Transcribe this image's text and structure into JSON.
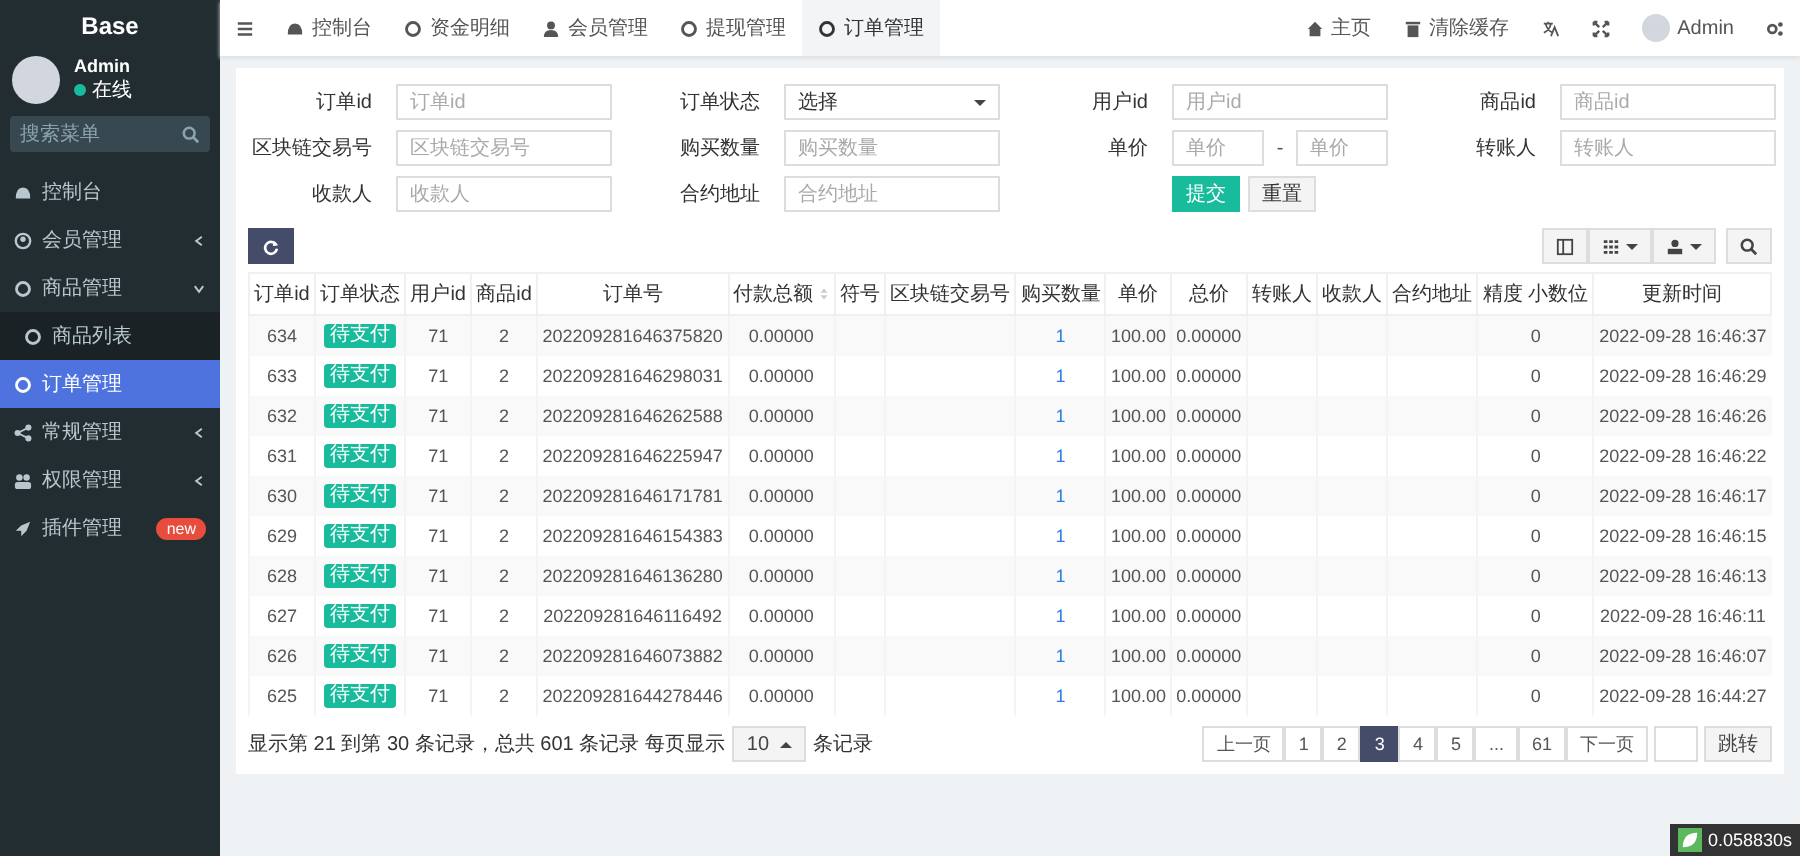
{
  "sidebar": {
    "logo": "Base",
    "user": {
      "name": "Admin",
      "status": "在线"
    },
    "search": {
      "placeholder": "搜索菜单"
    },
    "menu": [
      {
        "label": "控制台",
        "selected": false
      },
      {
        "label": "会员管理",
        "selected": false,
        "expanded": false
      },
      {
        "label": "商品管理",
        "selected": false,
        "expanded": true,
        "children": [
          {
            "label": "商品列表",
            "selected": false
          }
        ]
      },
      {
        "label": "订单管理",
        "selected": true
      },
      {
        "label": "常规管理",
        "selected": false,
        "expanded": false
      },
      {
        "label": "权限管理",
        "selected": false,
        "expanded": false
      },
      {
        "label": "插件管理",
        "selected": false,
        "badge": "new"
      }
    ]
  },
  "topbar": {
    "tabs": [
      {
        "label": "控制台",
        "selected": false
      },
      {
        "label": "资金明细",
        "selected": false
      },
      {
        "label": "会员管理",
        "selected": false
      },
      {
        "label": "提现管理",
        "selected": false
      },
      {
        "label": "订单管理",
        "selected": true
      }
    ],
    "links": [
      "主页",
      "清除缓存"
    ],
    "user": "Admin"
  },
  "filter": {
    "fields": [
      {
        "label": "订单id",
        "kind": "input",
        "placeholder": "订单id"
      },
      {
        "label": "订单状态",
        "kind": "select",
        "value": "选择"
      },
      {
        "label": "用户id",
        "kind": "input",
        "placeholder": "用户id"
      },
      {
        "label": "商品id",
        "kind": "input",
        "placeholder": "商品id"
      },
      {
        "label": "区块链交易号",
        "kind": "input",
        "placeholder": "区块链交易号"
      },
      {
        "label": "购买数量",
        "kind": "input",
        "placeholder": "购买数量"
      },
      {
        "label": "单价",
        "kind": "range",
        "placeholder": "单价",
        "placeholder_to": "单价",
        "separator": "-"
      },
      {
        "label": "转账人",
        "kind": "input",
        "placeholder": "转账人"
      },
      {
        "label": "收款人",
        "kind": "input",
        "placeholder": "收款人"
      },
      {
        "label": "合约地址",
        "kind": "input",
        "placeholder": "合约地址"
      },
      {
        "kind": "buttons",
        "submit": "提交",
        "reset": "重置"
      }
    ]
  },
  "table": {
    "columns": [
      {
        "label": "订单id",
        "kind": "text"
      },
      {
        "label": "订单状态",
        "kind": "badge"
      },
      {
        "label": "用户id",
        "kind": "text"
      },
      {
        "label": "商品id",
        "kind": "text"
      },
      {
        "label": "订单号",
        "kind": "text"
      },
      {
        "label": "付款总额",
        "kind": "text",
        "sortable": true
      },
      {
        "label": "符号"
      },
      {
        "label": "区块链交易号"
      },
      {
        "label": "购买数量",
        "kind": "link"
      },
      {
        "label": "单价",
        "kind": "text"
      },
      {
        "label": "总价",
        "kind": "text"
      },
      {
        "label": "转账人"
      },
      {
        "label": "收款人"
      },
      {
        "label": "合约地址"
      },
      {
        "label": "精度 小数位",
        "kind": "text"
      },
      {
        "label": "更新时间",
        "kind": "text"
      }
    ],
    "rows": [
      {
        "cells": [
          "634",
          "待支付",
          "71",
          "2",
          "202209281646375820",
          "0.00000",
          "",
          "",
          "1",
          "100.00",
          "0.00000",
          "",
          "",
          "",
          "0",
          "2022-09-28 16:46:37"
        ]
      },
      {
        "cells": [
          "633",
          "待支付",
          "71",
          "2",
          "202209281646298031",
          "0.00000",
          "",
          "",
          "1",
          "100.00",
          "0.00000",
          "",
          "",
          "",
          "0",
          "2022-09-28 16:46:29"
        ]
      },
      {
        "cells": [
          "632",
          "待支付",
          "71",
          "2",
          "202209281646262588",
          "0.00000",
          "",
          "",
          "1",
          "100.00",
          "0.00000",
          "",
          "",
          "",
          "0",
          "2022-09-28 16:46:26"
        ]
      },
      {
        "cells": [
          "631",
          "待支付",
          "71",
          "2",
          "202209281646225947",
          "0.00000",
          "",
          "",
          "1",
          "100.00",
          "0.00000",
          "",
          "",
          "",
          "0",
          "2022-09-28 16:46:22"
        ]
      },
      {
        "cells": [
          "630",
          "待支付",
          "71",
          "2",
          "202209281646171781",
          "0.00000",
          "",
          "",
          "1",
          "100.00",
          "0.00000",
          "",
          "",
          "",
          "0",
          "2022-09-28 16:46:17"
        ]
      },
      {
        "cells": [
          "629",
          "待支付",
          "71",
          "2",
          "202209281646154383",
          "0.00000",
          "",
          "",
          "1",
          "100.00",
          "0.00000",
          "",
          "",
          "",
          "0",
          "2022-09-28 16:46:15"
        ]
      },
      {
        "cells": [
          "628",
          "待支付",
          "71",
          "2",
          "202209281646136280",
          "0.00000",
          "",
          "",
          "1",
          "100.00",
          "0.00000",
          "",
          "",
          "",
          "0",
          "2022-09-28 16:46:13"
        ]
      },
      {
        "cells": [
          "627",
          "待支付",
          "71",
          "2",
          "202209281646116492",
          "0.00000",
          "",
          "",
          "1",
          "100.00",
          "0.00000",
          "",
          "",
          "",
          "0",
          "2022-09-28 16:46:11"
        ]
      },
      {
        "cells": [
          "626",
          "待支付",
          "71",
          "2",
          "202209281646073882",
          "0.00000",
          "",
          "",
          "1",
          "100.00",
          "0.00000",
          "",
          "",
          "",
          "0",
          "2022-09-28 16:46:07"
        ]
      },
      {
        "cells": [
          "625",
          "待支付",
          "71",
          "2",
          "202209281644278446",
          "0.00000",
          "",
          "",
          "1",
          "100.00",
          "0.00000",
          "",
          "",
          "",
          "0",
          "2022-09-28 16:44:27"
        ]
      }
    ]
  },
  "footer": {
    "summary": "显示第 21 到第 30 条记录，总共 601 条记录 每页显示",
    "page_size": "10",
    "suffix": "条记录",
    "pages": [
      {
        "label": "上一页",
        "selected": false
      },
      {
        "label": "1",
        "selected": false
      },
      {
        "label": "2",
        "selected": false
      },
      {
        "label": "3",
        "selected": true
      },
      {
        "label": "4",
        "selected": false
      },
      {
        "label": "5",
        "selected": false
      },
      {
        "label": "...",
        "selected": false
      },
      {
        "label": "61",
        "selected": false
      },
      {
        "label": "下一页",
        "selected": false
      }
    ],
    "jump": "跳转"
  },
  "timer": "0.058830s"
}
